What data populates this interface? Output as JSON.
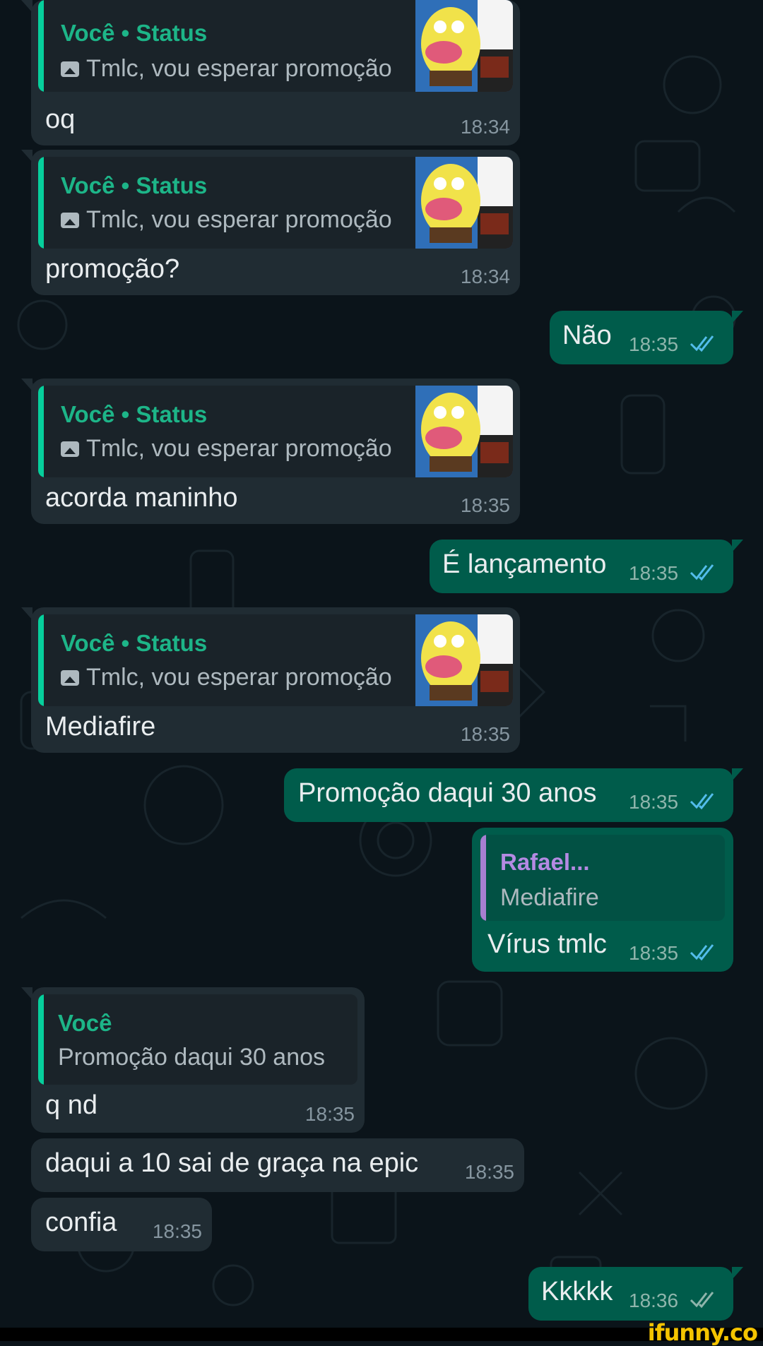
{
  "colors": {
    "background": "#0b141a",
    "incoming_bubble": "#202c33",
    "outgoing_bubble": "#005c4b",
    "quote_author_green": "#1db588",
    "quote_author_purple": "#b48ae3",
    "read_ticks": "#53bdeb",
    "watermark": "#f5c400"
  },
  "messages": [
    {
      "direction": "in",
      "quote_author": "Você • Status",
      "quote_text": "Tmlc, vou esperar promoção",
      "quote_icon": "photo-icon",
      "text": "oq",
      "time": "18:34"
    },
    {
      "direction": "in",
      "quote_author": "Você • Status",
      "quote_text": "Tmlc, vou esperar promoção",
      "quote_icon": "photo-icon",
      "text": "promoção?",
      "time": "18:34"
    },
    {
      "direction": "out",
      "text": "Não",
      "time": "18:35",
      "status": "read"
    },
    {
      "direction": "in",
      "quote_author": "Você • Status",
      "quote_text": "Tmlc, vou esperar promoção",
      "quote_icon": "photo-icon",
      "text": "acorda maninho",
      "time": "18:35"
    },
    {
      "direction": "out",
      "text": "É lançamento",
      "time": "18:35",
      "status": "read"
    },
    {
      "direction": "in",
      "quote_author": "Você • Status",
      "quote_text": "Tmlc, vou esperar promoção",
      "quote_icon": "photo-icon",
      "text": "Mediafire",
      "time": "18:35"
    },
    {
      "direction": "out",
      "text": "Promoção daqui 30 anos",
      "time": "18:35",
      "status": "read"
    },
    {
      "direction": "out",
      "quote_author": "Rafael...",
      "quote_text": "Mediafire",
      "text": "Vírus tmlc",
      "time": "18:35",
      "status": "read"
    },
    {
      "direction": "in",
      "quote_author": "Você",
      "quote_text": "Promoção daqui 30 anos",
      "text": "q nd",
      "time": "18:35"
    },
    {
      "direction": "in",
      "text": "daqui a 10 sai de graça na epic",
      "time": "18:35"
    },
    {
      "direction": "in",
      "text": "confia",
      "time": "18:35"
    },
    {
      "direction": "out",
      "text": "Kkkkk",
      "time": "18:36",
      "status": "read"
    }
  ],
  "watermark": "ifunny.co"
}
